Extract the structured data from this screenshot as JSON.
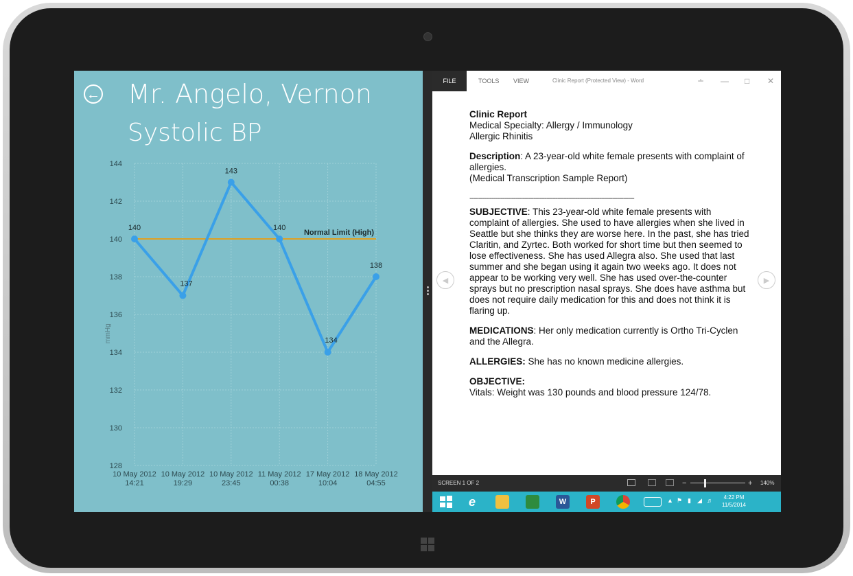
{
  "left_pane": {
    "patient_name": "Mr. Angelo, Vernon",
    "metric_title": "Systolic BP",
    "accent_color": "#3aa0e8",
    "limit_color": "#e0a020"
  },
  "chart_data": {
    "type": "line",
    "title": "",
    "ylabel": "mmHg",
    "xlabel": "",
    "ylim": [
      128,
      144
    ],
    "yticks": [
      128,
      130,
      132,
      134,
      136,
      138,
      140,
      142,
      144
    ],
    "categories": [
      [
        "10 May 2012",
        "14:21"
      ],
      [
        "10 May 2012",
        "19:29"
      ],
      [
        "10 May 2012",
        "23:45"
      ],
      [
        "11 May 2012",
        "00:38"
      ],
      [
        "17 May 2012",
        "10:04"
      ],
      [
        "18 May 2012",
        "04:55"
      ]
    ],
    "series": [
      {
        "values": [
          140,
          137,
          143,
          140,
          134,
          138
        ]
      }
    ],
    "data_labels": [
      "140",
      "137",
      "143",
      "140",
      "134",
      "138"
    ],
    "reference_line": {
      "value": 140,
      "label": "Normal Limit (High)"
    },
    "grid": true
  },
  "word": {
    "tabs": {
      "file": "FILE",
      "tools": "TOOLS",
      "view": "VIEW"
    },
    "window_title": "Clinic Report (Protected View) - Word",
    "doc": {
      "title": "Clinic Report",
      "specialty": "Medical Specialty: Allergy / Immunology",
      "sample_name": "Allergic Rhinitis",
      "description_label": "Description",
      "description_text": ": A 23-year-old white female presents with complaint of allergies.",
      "description_note": "(Medical Transcription Sample Report)",
      "rule": "------------------------------------------------------------------------------------------",
      "subjective_label": "SUBJECTIVE",
      "subjective_text": ": This 23-year-old white female presents with complaint of allergies. She used to have allergies when she lived in Seattle but she thinks they are worse here. In the past, she has tried Claritin, and Zyrtec. Both worked for short time but then seemed to lose effectiveness. She has used Allegra also. She used that last summer and she began using it again two weeks ago. It does not appear to be working very well. She has used over-the-counter sprays but no prescription nasal sprays. She does have asthma but does not require daily medication for this and does not think it is flaring up.",
      "medications_label": "MEDICATIONS",
      "medications_text": ": Her only medication currently is Ortho Tri-Cyclen and the Allegra.",
      "allergies_label": "ALLERGIES:",
      "allergies_text": " She has no known medicine allergies.",
      "objective_label": "OBJECTIVE:",
      "objective_text": "Vitals: Weight was 130 pounds and blood pressure 124/78."
    },
    "status": {
      "screen": "SCREEN 1 OF 2",
      "zoom": "140%"
    }
  },
  "taskbar": {
    "time": "4:22 PM",
    "date": "11/5/2014",
    "color": "#2bb3c8"
  }
}
